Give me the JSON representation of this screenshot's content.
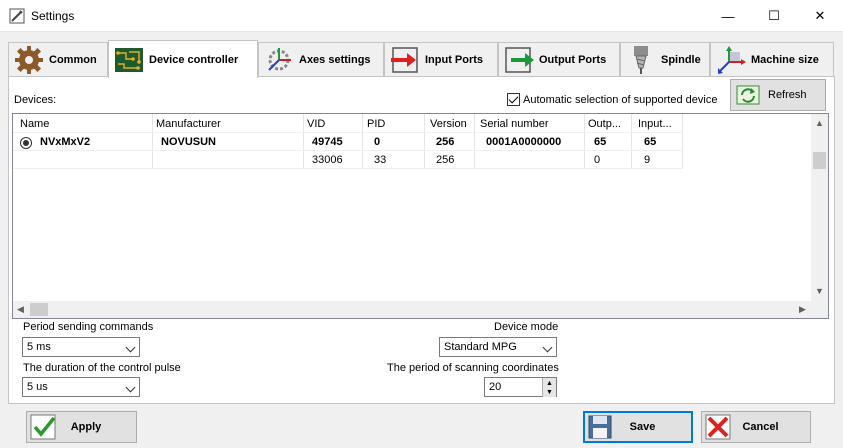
{
  "window": {
    "title": "Settings",
    "minimize": "—",
    "maximize": "☐",
    "close": "✕"
  },
  "tabs": [
    {
      "label": "Common",
      "icon": "gear-icon"
    },
    {
      "label": "Device controller",
      "icon": "circuit-board-icon"
    },
    {
      "label": "Axes settings",
      "icon": "axes-gear-icon"
    },
    {
      "label": "Input Ports",
      "icon": "input-arrow-icon"
    },
    {
      "label": "Output Ports",
      "icon": "output-arrow-icon"
    },
    {
      "label": "Spindle",
      "icon": "spindle-icon"
    },
    {
      "label": "Machine size",
      "icon": "machine-axes-icon"
    }
  ],
  "active_tab": "Device controller",
  "devices_label": "Devices:",
  "auto_select": {
    "label": "Automatic selection of supported device",
    "checked": true
  },
  "refresh_label": "Refresh",
  "table": {
    "columns": [
      "Name",
      "Manufacturer",
      "VID",
      "PID",
      "Version",
      "Serial number",
      "Outp...",
      "Input..."
    ],
    "rows": [
      {
        "selected": true,
        "bold": true,
        "cells": [
          "NVxMxV2",
          "NOVUSUN",
          "49745",
          "0",
          "256",
          "0001A0000000",
          "65",
          "65"
        ]
      },
      {
        "selected": false,
        "bold": false,
        "cells": [
          "",
          "",
          "33006",
          "33",
          "256",
          "",
          "0",
          "9"
        ]
      }
    ]
  },
  "period_sending": {
    "label": "Period sending commands",
    "value": "5 ms"
  },
  "control_pulse": {
    "label": "The duration of the control pulse",
    "value": "5 us"
  },
  "device_mode": {
    "label": "Device mode",
    "value": "Standard MPG"
  },
  "scan_period": {
    "label": "The period of scanning coordinates",
    "value": "20"
  },
  "buttons": {
    "apply": "Apply",
    "save": "Save",
    "cancel": "Cancel"
  },
  "colors": {
    "accent": "#0078d7",
    "input_red": "#e02020",
    "output_green": "#1a9a3a"
  }
}
